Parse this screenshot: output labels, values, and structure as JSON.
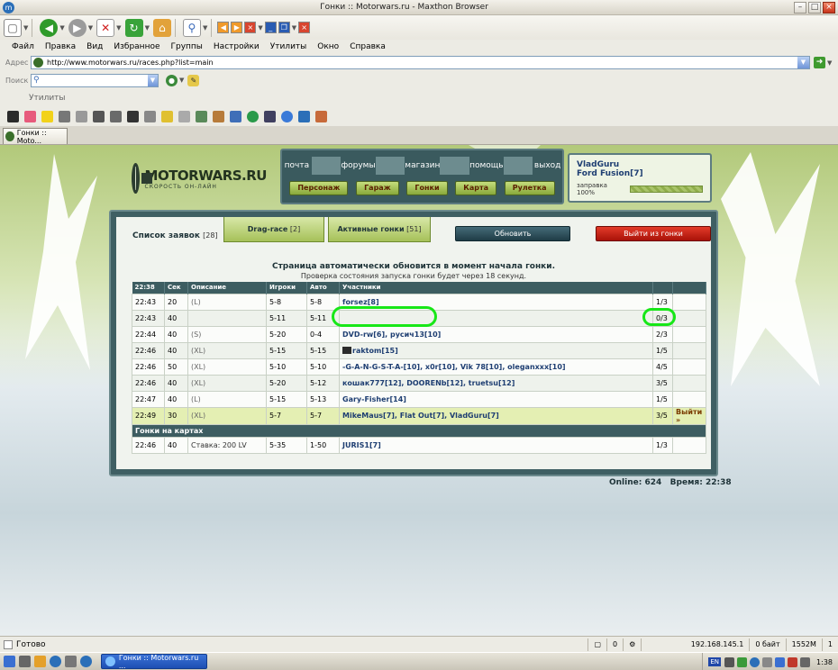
{
  "window": {
    "title": "Гонки :: Motorwars.ru - Maxthon Browser"
  },
  "menu": [
    "Файл",
    "Правка",
    "Вид",
    "Избранное",
    "Группы",
    "Настройки",
    "Утилиты",
    "Окно",
    "Справка"
  ],
  "address": {
    "label": "Адрес",
    "url": "http://www.motorwars.ru/races.php?list=main"
  },
  "search": {
    "label": "Поиск",
    "value": ""
  },
  "utility_bar_label": "Утилиты",
  "tab": {
    "label": "Гонки :: Moto..."
  },
  "site": {
    "brand": "MOTORWARS.RU",
    "slogan": "СКОРОСТЬ ОН-ЛАЙН",
    "nav_top": [
      "почта",
      "форумы",
      "магазин",
      "помощь",
      "выход"
    ],
    "nav_buttons": [
      "Персонаж",
      "Гараж",
      "Гонки",
      "Карта",
      "Рулетка"
    ],
    "user": {
      "name": "VladGuru",
      "car": "Ford Fusion[7]",
      "fuel_label": "заправка 100%",
      "fuel_percent": 100
    }
  },
  "races": {
    "list_title": "Список заявок",
    "list_count": "[28]",
    "tab_drag": "Drag-race",
    "tab_drag_count": "[2]",
    "tab_active": "Активные гонки",
    "tab_active_count": "[51]",
    "refresh_label": "Обновить",
    "exit_label": "Выйти из гонки",
    "notice": "Страница автоматически обновится в момент начала гонки.",
    "notice2": "Проверка состояния запуска гонки будет через 18 секунд.",
    "columns": [
      "22:38",
      "Сек",
      "Описание",
      "Игроки",
      "Авто",
      "Участники"
    ],
    "rows": [
      {
        "time": "22:43",
        "sec": "20",
        "desc": "(L)",
        "players": "5-8",
        "auto": "5-8",
        "participants": "forsez[8]",
        "count": "1/3",
        "action": ""
      },
      {
        "time": "22:43",
        "sec": "40",
        "desc": "",
        "players": "5-11",
        "auto": "5-11",
        "participants": "",
        "count": "0/3",
        "action": ""
      },
      {
        "time": "22:44",
        "sec": "40",
        "desc": "(S)",
        "players": "5-20",
        "auto": "0-4",
        "participants": "DVD-rw[6], русич13[10]",
        "count": "2/3",
        "action": ""
      },
      {
        "time": "22:46",
        "sec": "40",
        "desc": "(XL)",
        "players": "5-15",
        "auto": "5-15",
        "participants": "raktom[15]",
        "count": "1/5",
        "action": ""
      },
      {
        "time": "22:46",
        "sec": "50",
        "desc": "(XL)",
        "players": "5-10",
        "auto": "5-10",
        "participants": "-G-A-N-G-S-T-A-[10], x0r[10], Vik 78[10], oleganxxx[10]",
        "count": "4/5",
        "action": ""
      },
      {
        "time": "22:46",
        "sec": "40",
        "desc": "(XL)",
        "players": "5-20",
        "auto": "5-12",
        "participants": "кошак777[12], DOORENb[12], truetsu[12]",
        "count": "3/5",
        "action": ""
      },
      {
        "time": "22:47",
        "sec": "40",
        "desc": "(L)",
        "players": "5-15",
        "auto": "5-13",
        "participants": "Gary-Fisher[14]",
        "count": "1/5",
        "action": ""
      },
      {
        "time": "22:49",
        "sec": "30",
        "desc": "(XL)",
        "players": "5-7",
        "auto": "5-7",
        "participants": "MikeMaus[7], Flat Out[7], VladGuru[7]",
        "count": "3/5",
        "action": "Выйти »"
      }
    ],
    "map_section": "Гонки на картах",
    "map_rows": [
      {
        "time": "22:46",
        "sec": "40",
        "desc": "Ставка: 200 LV",
        "players": "5-35",
        "auto": "1-50",
        "participants": "JURIS1[7]",
        "count": "1/3"
      }
    ],
    "online_label": "Online: 624",
    "time_label": "Время: 22:38"
  },
  "status": {
    "text": "Готово",
    "count": "0",
    "ip": "192.168.145.1",
    "bytes": "0 байт",
    "memory": "1552M",
    "tabs": "1"
  },
  "taskbar": {
    "item": "Гонки :: Motorwars.ru ...",
    "lang": "EN",
    "clock": "1:38"
  }
}
